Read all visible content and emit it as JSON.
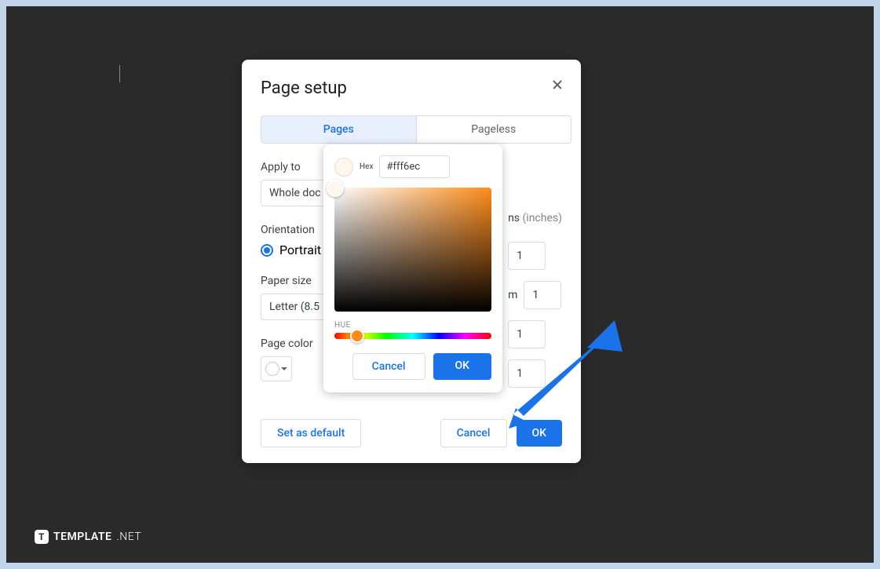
{
  "dialog": {
    "title": "Page setup",
    "tabs": {
      "pages": "Pages",
      "pageless": "Pageless"
    },
    "apply_to": {
      "label": "Apply to",
      "value": "Whole doc"
    },
    "orientation": {
      "label": "Orientation",
      "portrait": "Portrait"
    },
    "paper_size": {
      "label": "Paper size",
      "value": "Letter (8.5"
    },
    "page_color": {
      "label": "Page color"
    },
    "margins": {
      "header_prefix": "ns",
      "header_unit": " (inches)",
      "bottom_label": "m",
      "top": "1",
      "bottom": "1",
      "left": "1",
      "right": "1"
    },
    "buttons": {
      "set_default": "Set as default",
      "cancel": "Cancel",
      "ok": "OK"
    }
  },
  "picker": {
    "hex_label": "Hex",
    "hex_value": "#fff6ec",
    "hue_label": "HUE",
    "buttons": {
      "cancel": "Cancel",
      "ok": "OK"
    }
  },
  "watermark": {
    "brand": "TEMPLATE",
    "suffix": ".NET",
    "badge": "T"
  }
}
